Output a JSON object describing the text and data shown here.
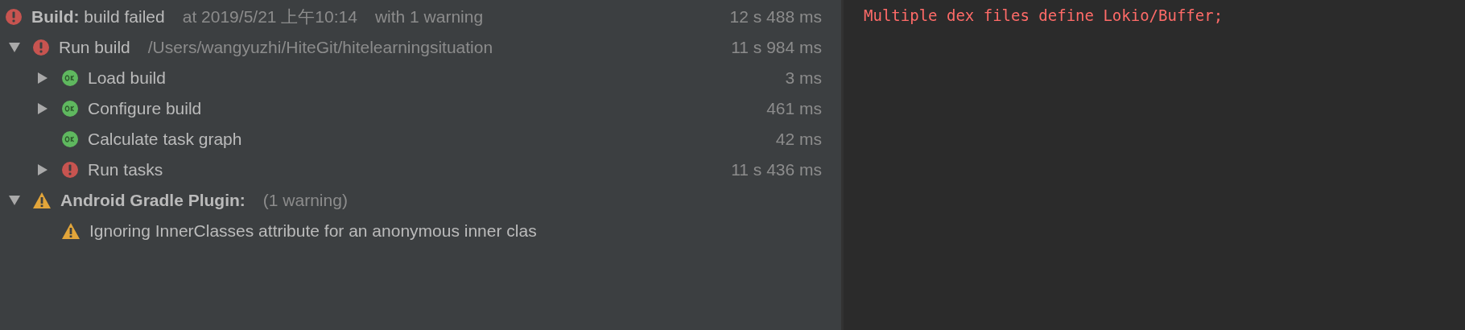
{
  "build_tree": [
    {
      "kind": "error",
      "label": "**Build:** build failed",
      "detail": "at 2019/5/21 上午10:14",
      "extra": "with 1 warning",
      "duration": "12 s 488 ms",
      "children": [
        {
          "kind": "error",
          "expanded": true,
          "label": "Run build",
          "detail": "/Users/wangyuzhi/HiteGit/hitelearningsituation",
          "duration": "11 s 984 ms",
          "children": [
            {
              "kind": "ok",
              "expanded": false,
              "label": "Load build",
              "duration": "3 ms"
            },
            {
              "kind": "ok",
              "expanded": false,
              "label": "Configure build",
              "duration": "461 ms"
            },
            {
              "kind": "ok",
              "label": "Calculate task graph",
              "duration": "42 ms"
            },
            {
              "kind": "error",
              "expanded": false,
              "label": "Run tasks",
              "duration": "11 s 436 ms"
            }
          ]
        },
        {
          "kind": "warning",
          "expanded": true,
          "label": "**Android Gradle Plugin:**",
          "detail": "(1 warning)",
          "children": [
            {
              "kind": "warning",
              "label": "Ignoring InnerClasses attribute for an anonymous inner clas"
            }
          ]
        }
      ]
    }
  ],
  "console": {
    "lines": [
      "Multiple dex files define Lokio/Buffer;"
    ]
  }
}
